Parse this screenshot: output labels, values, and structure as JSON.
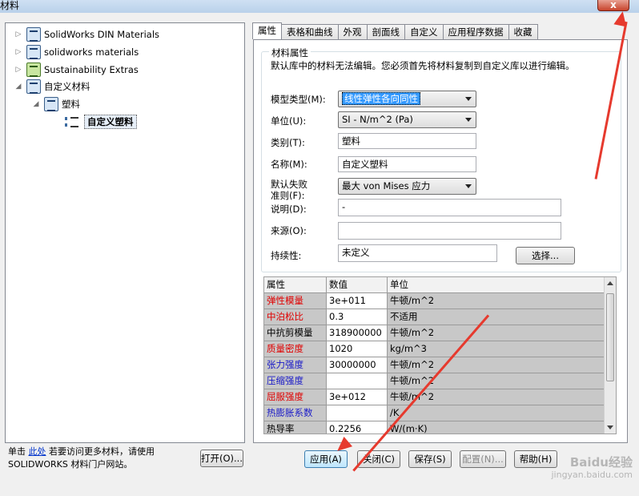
{
  "window": {
    "title": "材料",
    "close_label": "x"
  },
  "tree": {
    "items": [
      {
        "label": "SolidWorks DIN Materials"
      },
      {
        "label": "solidworks materials"
      },
      {
        "label": "Sustainability Extras"
      },
      {
        "label": "自定义材料"
      },
      {
        "label": "塑料"
      },
      {
        "label": "自定义塑料"
      }
    ]
  },
  "footer": {
    "prefix": "单击",
    "link": "此处",
    "suffix": "若要访问更多材料，请使用 SOLIDWORKS 材料门户网站。",
    "open_button": "打开(O)..."
  },
  "tabs": [
    "属性",
    "表格和曲线",
    "外观",
    "剖面线",
    "自定义",
    "应用程序数据",
    "收藏"
  ],
  "properties": {
    "group_title": "材料属性",
    "description": "默认库中的材料无法编辑。您必须首先将材料复制到自定义库以进行编辑。",
    "model_type_label": "模型类型(M):",
    "model_type_value": "线性弹性各向同性",
    "units_label": "单位(U):",
    "units_value": "SI - N/m^2 (Pa)",
    "category_label": "类别(T):",
    "category_value": "塑料",
    "name_label": "名称(M):",
    "name_value": "自定义塑料",
    "failure_label_1": "默认失败",
    "failure_label_2": "准则(F):",
    "failure_value": "最大 von Mises 应力",
    "desc_label": "说明(D):",
    "desc_value": "-",
    "source_label": "来源(O):",
    "source_value": "",
    "sustain_label": "持续性:",
    "sustain_value": "未定义",
    "select_button": "选择..."
  },
  "table": {
    "headers": [
      "属性",
      "数值",
      "单位"
    ],
    "rows": [
      {
        "name": "弹性模量",
        "value": "3e+011",
        "unit": "牛顿/m^2",
        "color": "#e00000"
      },
      {
        "name": "中泊松比",
        "value": "0.3",
        "unit": "不适用",
        "color": "#e00000"
      },
      {
        "name": "中抗剪模量",
        "value": "318900000",
        "unit": "牛顿/m^2",
        "color": "#000000"
      },
      {
        "name": "质量密度",
        "value": "1020",
        "unit": "kg/m^3",
        "color": "#e00000"
      },
      {
        "name": "张力强度",
        "value": "30000000",
        "unit": "牛顿/m^2",
        "color": "#1a1ac8"
      },
      {
        "name": "压缩强度",
        "value": "",
        "unit": "牛顿/m^2",
        "color": "#1a1ac8"
      },
      {
        "name": "屈服强度",
        "value": "3e+012",
        "unit": "牛顿/m^2",
        "color": "#e00000"
      },
      {
        "name": "热膨胀系数",
        "value": "",
        "unit": "/K",
        "color": "#1a1ac8"
      },
      {
        "name": "热导率",
        "value": "0.2256",
        "unit": "W/(m·K)",
        "color": "#000000"
      }
    ]
  },
  "buttons": {
    "apply": "应用(A)",
    "close": "关闭(C)",
    "save": "保存(S)",
    "config": "配置(N)...",
    "help": "帮助(H)"
  },
  "watermark": {
    "line1": "Baidu经验",
    "line2": "jingyan.baidu.com"
  },
  "colors": {
    "annotation_arrow": "#e63a2e",
    "selection": "#3399ff"
  }
}
